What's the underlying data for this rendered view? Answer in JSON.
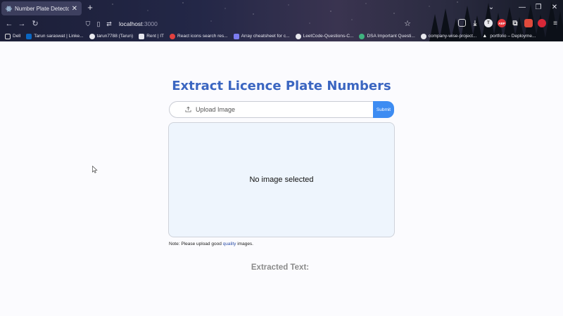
{
  "browser": {
    "tab": {
      "title": "Number Plate Detector"
    },
    "url": {
      "host": "localhost",
      "port": ":3000"
    },
    "bookmarks": [
      "Dell",
      "Tarun saraswat | Linke...",
      "tarun7788 (Tarun)",
      "Rent | IT",
      "React icons search res...",
      "Array cheatsheet for c...",
      "LeetCode-Questions-C...",
      "DSA Important Questi...",
      "company-wise-project...",
      "portfolio – Deployme..."
    ],
    "extensions": {
      "abp_label": "ABP"
    }
  },
  "page": {
    "heading": "Extract Licence Plate Numbers",
    "upload": {
      "placeholder": "Upload Image",
      "submit_label": "Submit"
    },
    "preview_text": "No image selected",
    "note": {
      "before": "Note: Please upload good ",
      "highlight": "quality",
      "after": " images."
    },
    "extracted_label": "Extracted Text:"
  }
}
